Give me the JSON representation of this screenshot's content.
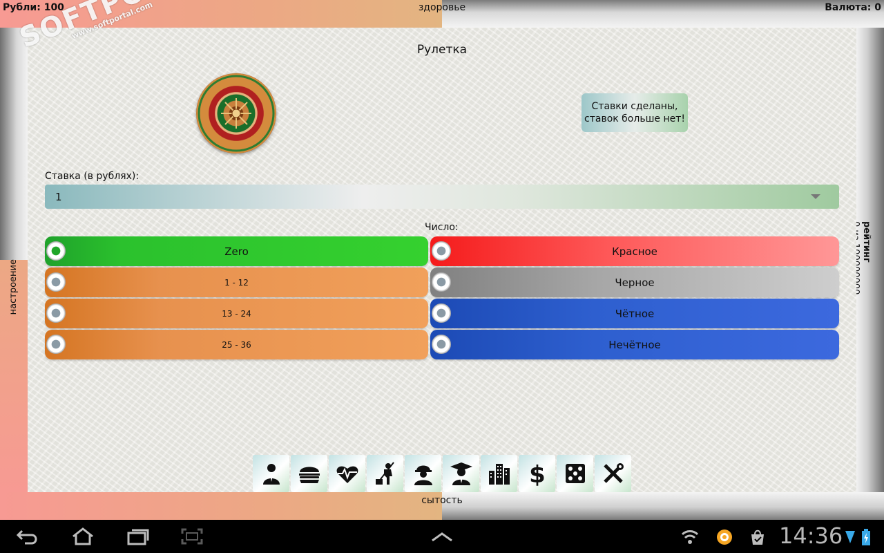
{
  "top": {
    "money": "Рубли: 100",
    "health": "здоровье",
    "currency": "Валюта: 0"
  },
  "left_indicator": "настроение",
  "right_indicator": {
    "label": "рейтинг",
    "value": "0 из 100000000"
  },
  "bottom_indicator": "сытость",
  "title": "Рулетка",
  "message": {
    "line1": "Ставки сделаны,",
    "line2": "ставок больше нет!"
  },
  "stake": {
    "label": "Ставка (в рублях):",
    "value": "1"
  },
  "number_label": "Число:",
  "bets_left": [
    {
      "label": "Zero",
      "checked": true
    },
    {
      "label": "1 - 12",
      "checked": false
    },
    {
      "label": "13 - 24",
      "checked": false
    },
    {
      "label": "25 - 36",
      "checked": false
    }
  ],
  "bets_right": [
    {
      "label": "Красное",
      "checked": false
    },
    {
      "label": "Черное",
      "checked": false
    },
    {
      "label": "Чётное",
      "checked": false
    },
    {
      "label": "Нечётное",
      "checked": false
    }
  ],
  "toolbar": [
    "person-icon",
    "burger-icon",
    "heart-icon",
    "janitor-icon",
    "worker-icon",
    "graduate-icon",
    "buildings-icon",
    "dollar-icon",
    "dice-icon",
    "tools-icon"
  ],
  "system": {
    "time": "14:36"
  },
  "watermark": {
    "brand": "SOFTPORTAL",
    "url": "www.softportal.com"
  }
}
